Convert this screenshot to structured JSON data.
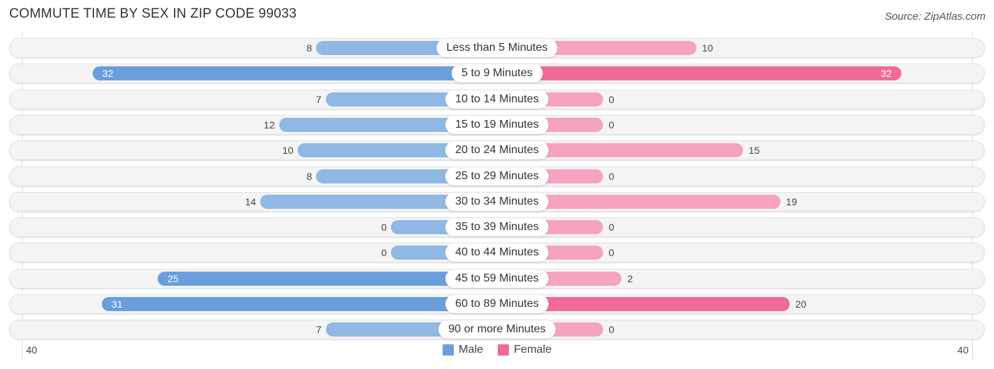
{
  "chart_data": {
    "type": "bar",
    "title": "COMMUTE TIME BY SEX IN ZIP CODE 99033",
    "source": "Source: ZipAtlas.com",
    "orientation": "horizontal-diverging",
    "categories": [
      "Less than 5 Minutes",
      "5 to 9 Minutes",
      "10 to 14 Minutes",
      "15 to 19 Minutes",
      "20 to 24 Minutes",
      "25 to 29 Minutes",
      "30 to 34 Minutes",
      "35 to 39 Minutes",
      "40 to 44 Minutes",
      "45 to 59 Minutes",
      "60 to 89 Minutes",
      "90 or more Minutes"
    ],
    "series": [
      {
        "name": "Male",
        "color": "#6a9fdb",
        "values": [
          8,
          32,
          7,
          12,
          10,
          8,
          14,
          0,
          0,
          25,
          31,
          7
        ]
      },
      {
        "name": "Female",
        "color": "#f06b97",
        "values": [
          10,
          32,
          0,
          0,
          15,
          0,
          19,
          0,
          0,
          2,
          20,
          0
        ]
      }
    ],
    "axis": {
      "left_label": "40",
      "right_label": "40",
      "max": 40
    },
    "legend": {
      "placement": "bottom-center",
      "items": [
        "Male",
        "Female"
      ]
    }
  }
}
